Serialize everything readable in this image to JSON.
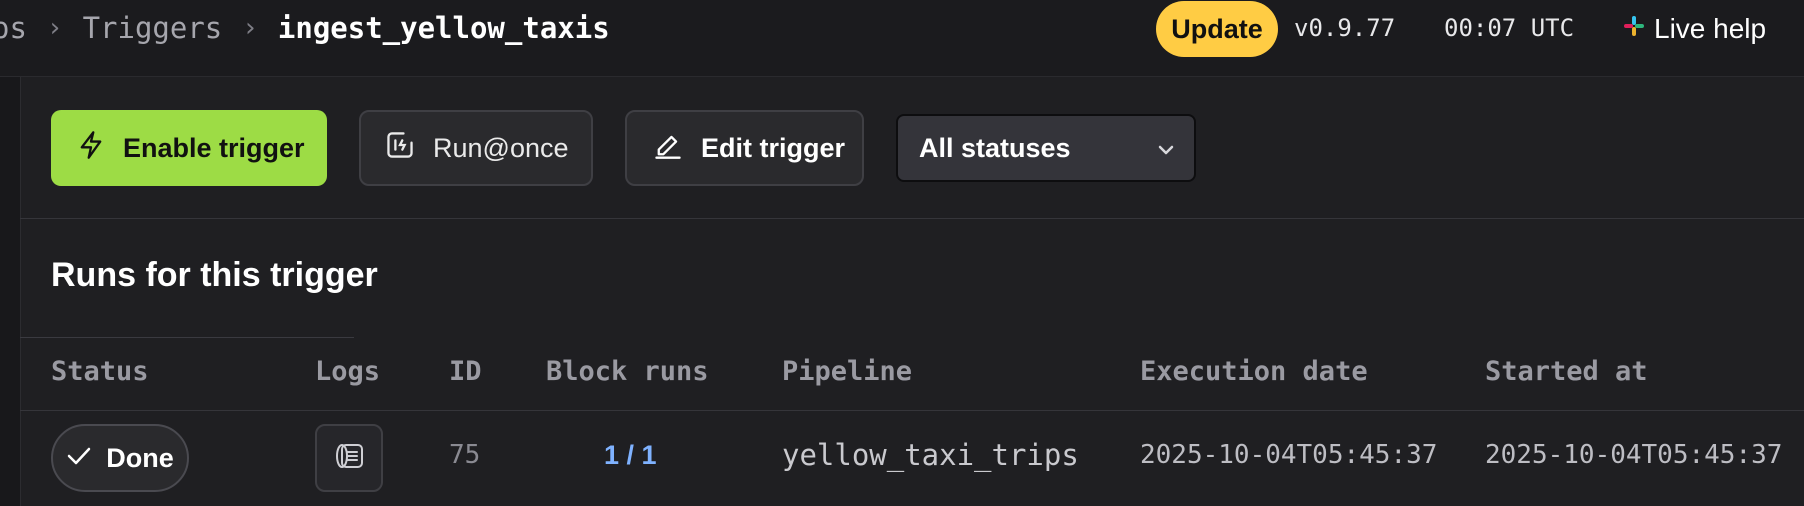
{
  "header": {
    "breadcrumb": {
      "prev": "os",
      "middle": "Triggers",
      "current": "ingest_yellow_taxis"
    },
    "update_label": "Update",
    "version": "v0.9.77",
    "clock": "00:07 UTC",
    "live_help_label": "Live help"
  },
  "toolbar": {
    "enable_label": "Enable trigger",
    "run_once_label": "Run@once",
    "edit_label": "Edit trigger",
    "status_filter": "All statuses"
  },
  "section": {
    "title": "Runs for this trigger"
  },
  "table": {
    "columns": [
      "Status",
      "Logs",
      "ID",
      "Block runs",
      "Pipeline",
      "Execution date",
      "Started at"
    ],
    "rows": [
      {
        "status": "Done",
        "id": "75",
        "block_runs": "1 / 1",
        "pipeline": "yellow_taxi_trips",
        "execution_date": "2025-10-04T05:45:37",
        "started_at": "2025-10-04T05:45:37"
      }
    ]
  },
  "colors": {
    "enable_green": "#9ddc45",
    "update_yellow": "#ffcc44",
    "link_blue": "#7fb2ff",
    "background": "#1f1f22"
  },
  "icons": {
    "enable": "lightning-icon",
    "run_once": "run-once-icon",
    "edit": "pencil-icon",
    "dropdown": "chevron-down-icon",
    "live_help": "slack-icon",
    "done": "checkmark-icon",
    "logs": "logs-icon"
  }
}
